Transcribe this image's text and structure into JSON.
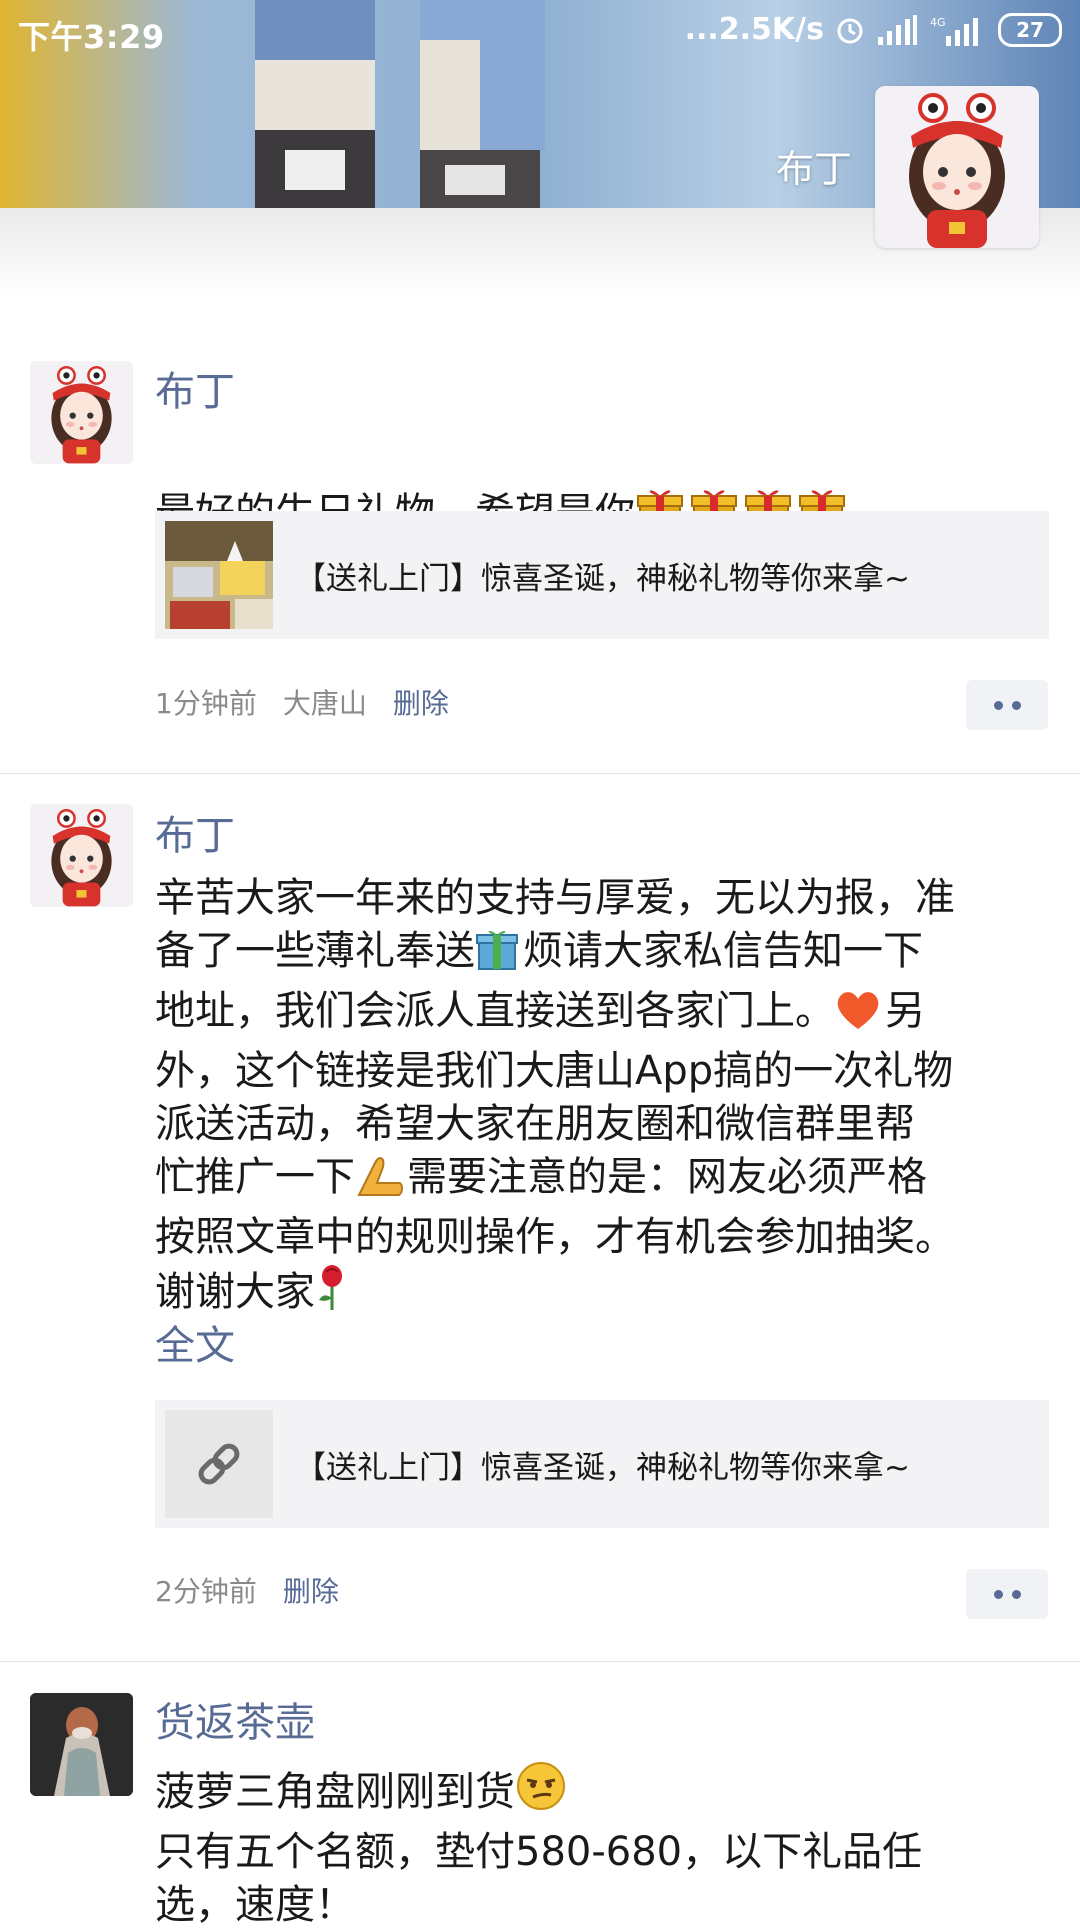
{
  "status_bar": {
    "time": "下午3:29",
    "net_speed": "...2.5K/s",
    "network": "4G",
    "battery": "27"
  },
  "cover": {
    "user_name": "布丁"
  },
  "posts": [
    {
      "author": "布丁",
      "text": "最好的生日礼物，希望是你",
      "text_icons": [
        "gift-icon",
        "gift-icon",
        "gift-icon",
        "gift-icon"
      ],
      "link_card": {
        "thumb_icon": "gift-photo-thumbnail",
        "title": "【送礼上门】惊喜圣诞，神秘礼物等你来拿~"
      },
      "meta": {
        "time": "1分钟前",
        "source": "大唐山",
        "delete": "删除"
      }
    },
    {
      "author": "布丁",
      "text_parts": [
        "辛苦大家一年来的支持与厚爱，无以为报，准\n备了一些薄礼奉送",
        "烦请大家私信告知一下\n地址，我们会派人直接送到各家门上。",
        "另\n外，这个链接是我们大唐山App搞的一次礼物\n派送活动，希望大家在朋友圈和微信群里帮\n忙推广一下",
        "需要注意的是：网友必须严格\n按照文章中的规则操作，才有机会参加抽奖。\n谢谢大家",
        ""
      ],
      "text_icons": [
        "wrapped-gift-icon",
        "heart-icon",
        "praying-hands-icon",
        "rose-icon"
      ],
      "full_text_label": "全文",
      "link_card": {
        "thumb_icon": "link-icon",
        "title": "【送礼上门】惊喜圣诞，神秘礼物等你来拿~"
      },
      "meta": {
        "time": "2分钟前",
        "delete": "删除"
      }
    },
    {
      "author": "货返茶壶",
      "text_parts": [
        "菠萝三角盘刚刚到货",
        "\n只有五个名额，垫付580-680，以下礼品任\n选，速度！"
      ],
      "text_icons": [
        "smirk-face-icon"
      ]
    }
  ],
  "colors": {
    "link_blue": "#576b95",
    "card_bg": "#f3f3f5",
    "meta_gray": "#8a8a8a"
  }
}
